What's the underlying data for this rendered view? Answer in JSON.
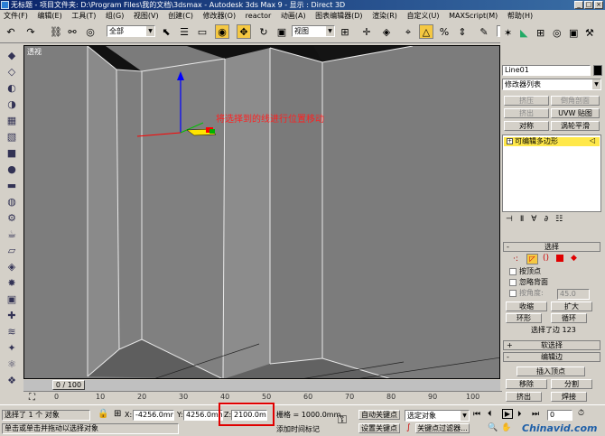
{
  "window": {
    "title": "无标题    - 项目文件夹: D:\\Program Files\\我的文档\\3dsmax    - Autodesk 3ds Max 9    - 显示 : Direct 3D",
    "min": "_",
    "max": "□",
    "close": "×"
  },
  "menu": [
    "文件(F)",
    "编辑(E)",
    "工具(T)",
    "组(G)",
    "视图(V)",
    "创建(C)",
    "修改器(O)",
    "reactor",
    "动画(A)",
    "图表编辑器(D)",
    "渲染(R)",
    "自定义(U)",
    "MAXScript(M)",
    "帮助(H)"
  ],
  "toolbar": {
    "selection_filter": "全部",
    "coord_system": "视图",
    "named_selection": "",
    "icons": [
      "undo-icon",
      "redo-icon",
      "link-icon",
      "unlink-icon",
      "bind-icon",
      "select-icon",
      "select-name-icon",
      "rect-select-icon",
      "window-crossing-icon",
      "move-icon",
      "rotate-icon",
      "scale-icon",
      "pivot-icon",
      "mirror-icon",
      "align-icon",
      "snap-icon",
      "angle-snap-icon",
      "percent-snap-icon",
      "spinner-snap-icon",
      "edit-named-icon",
      "curve-editor-icon",
      "schematic-icon",
      "material-icon",
      "render-setup-icon",
      "quick-render-icon",
      "render-type-icon"
    ]
  },
  "viewport": {
    "label": "透视",
    "annotation": "将选择到的线进行位置移动",
    "annotation_color": "#ff2020",
    "background": "#7b7b7b"
  },
  "panel": {
    "object_name": "Line01",
    "object_color": "#000000",
    "modifier_list": "修改器列表",
    "buttons": [
      {
        "label": "挤压",
        "enabled": false
      },
      {
        "label": "倒角剖面",
        "enabled": false
      },
      {
        "label": "挤出",
        "enabled": false
      },
      {
        "label": "UVW 贴图",
        "enabled": true
      },
      {
        "label": "对称",
        "enabled": true
      },
      {
        "label": "涡轮平滑",
        "enabled": true
      }
    ],
    "stack_item": "可编辑多边形",
    "stack_highlight": "#ffe84a",
    "rollout_selection": "选择",
    "by_vertex": "按顶点",
    "ignore_backface": "忽略背面",
    "by_angle": "按角度:",
    "angle_value": "45.0",
    "shrink": "收缩",
    "grow": "扩大",
    "ring": "环形",
    "loop": "循环",
    "selected_count": "选择了边 123",
    "soft_selection": "软选择",
    "edit_edges": "编辑边",
    "insert_vertex": "插入顶点",
    "remove": "移除",
    "split": "分割",
    "extrude": "挤出",
    "weld": "焊接"
  },
  "timeline": {
    "slider": "0 / 100",
    "ticks": [
      "0",
      "10",
      "20",
      "30",
      "40",
      "50",
      "60",
      "70",
      "80",
      "90",
      "100"
    ]
  },
  "status": {
    "selected": "选择了 1 个 对象",
    "prompt": "单击或单击并拖动以选择对象",
    "x_label": "X:",
    "x_value": "-4256.0mm",
    "y_label": "Y:",
    "y_value": "4256.0mm",
    "z_label": "Z:",
    "z_value": "2100.0mm",
    "grid": "栅格 = 1000.0mm",
    "add_time_tag": "添加时间标记",
    "auto_key": "自动关键点",
    "set_key": "设置关键点",
    "key_mode": "选定对象",
    "key_filters": "关键点过滤器...",
    "frame": "0",
    "watermark": "Chinavid.com",
    "highlight_color": "#e00000"
  }
}
